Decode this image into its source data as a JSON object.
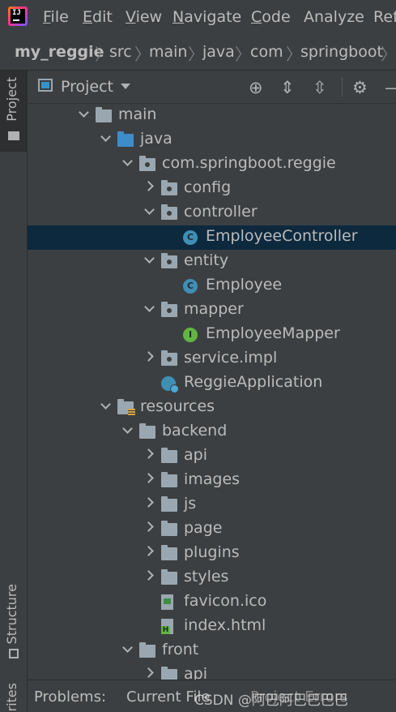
{
  "menu": {
    "items": [
      {
        "label": "File",
        "mnemonic": "F",
        "rest": "ile"
      },
      {
        "label": "Edit",
        "mnemonic": "E",
        "rest": "dit"
      },
      {
        "label": "View",
        "mnemonic": "V",
        "rest": "iew"
      },
      {
        "label": "Navigate",
        "mnemonic": "N",
        "rest": "avigate"
      },
      {
        "label": "Code",
        "mnemonic": "C",
        "rest": "ode"
      },
      {
        "label": "Analyze",
        "mnemonic": "",
        "rest": "Analyze"
      },
      {
        "label": "Ref",
        "mnemonic": "",
        "rest": "Ref"
      }
    ]
  },
  "breadcrumb": [
    "my_reggie",
    "src",
    "main",
    "java",
    "com",
    "springboot"
  ],
  "left_strip": {
    "project_tab": "Project",
    "structure_tab": "Structure",
    "favorites_tab": "rites"
  },
  "panel": {
    "title": "Project"
  },
  "tree": [
    {
      "label": "main",
      "chevron": "down",
      "icon": "folder"
    },
    {
      "label": "java",
      "chevron": "down",
      "icon": "folder-source"
    },
    {
      "label": "com.springboot.reggie",
      "chevron": "down",
      "icon": "package"
    },
    {
      "label": "config",
      "chevron": "right",
      "icon": "package"
    },
    {
      "label": "controller",
      "chevron": "down",
      "icon": "package"
    },
    {
      "label": "EmployeeController",
      "chevron": "",
      "icon": "class",
      "selected": true
    },
    {
      "label": "entity",
      "chevron": "down",
      "icon": "package"
    },
    {
      "label": "Employee",
      "chevron": "",
      "icon": "class"
    },
    {
      "label": "mapper",
      "chevron": "down",
      "icon": "package"
    },
    {
      "label": "EmployeeMapper",
      "chevron": "",
      "icon": "interface"
    },
    {
      "label": "service.impl",
      "chevron": "right",
      "icon": "package"
    },
    {
      "label": "ReggieApplication",
      "chevron": "",
      "icon": "spring-app"
    },
    {
      "label": "resources",
      "chevron": "down",
      "icon": "folder-resources"
    },
    {
      "label": "backend",
      "chevron": "down",
      "icon": "folder"
    },
    {
      "label": "api",
      "chevron": "right",
      "icon": "folder"
    },
    {
      "label": "images",
      "chevron": "right",
      "icon": "folder"
    },
    {
      "label": "js",
      "chevron": "right",
      "icon": "folder"
    },
    {
      "label": "page",
      "chevron": "right",
      "icon": "folder"
    },
    {
      "label": "plugins",
      "chevron": "right",
      "icon": "folder"
    },
    {
      "label": "styles",
      "chevron": "right",
      "icon": "folder"
    },
    {
      "label": "favicon.ico",
      "chevron": "",
      "icon": "image-file"
    },
    {
      "label": "index.html",
      "chevron": "",
      "icon": "html-file"
    },
    {
      "label": "front",
      "chevron": "down",
      "icon": "folder"
    },
    {
      "label": "api",
      "chevron": "right",
      "icon": "folder"
    }
  ],
  "bottom_tabs": {
    "problems": "Problems:",
    "current_file": "Current File",
    "project_errors": "Project Errors"
  },
  "watermark": "CSDN @阿巴阿巴巴巴巴",
  "colors": {
    "selection": "#0d293e",
    "background": "#3c3f41",
    "package_icon": "#9aa7b0",
    "class_icon": "#3f8fb5",
    "interface_icon": "#62b543"
  }
}
